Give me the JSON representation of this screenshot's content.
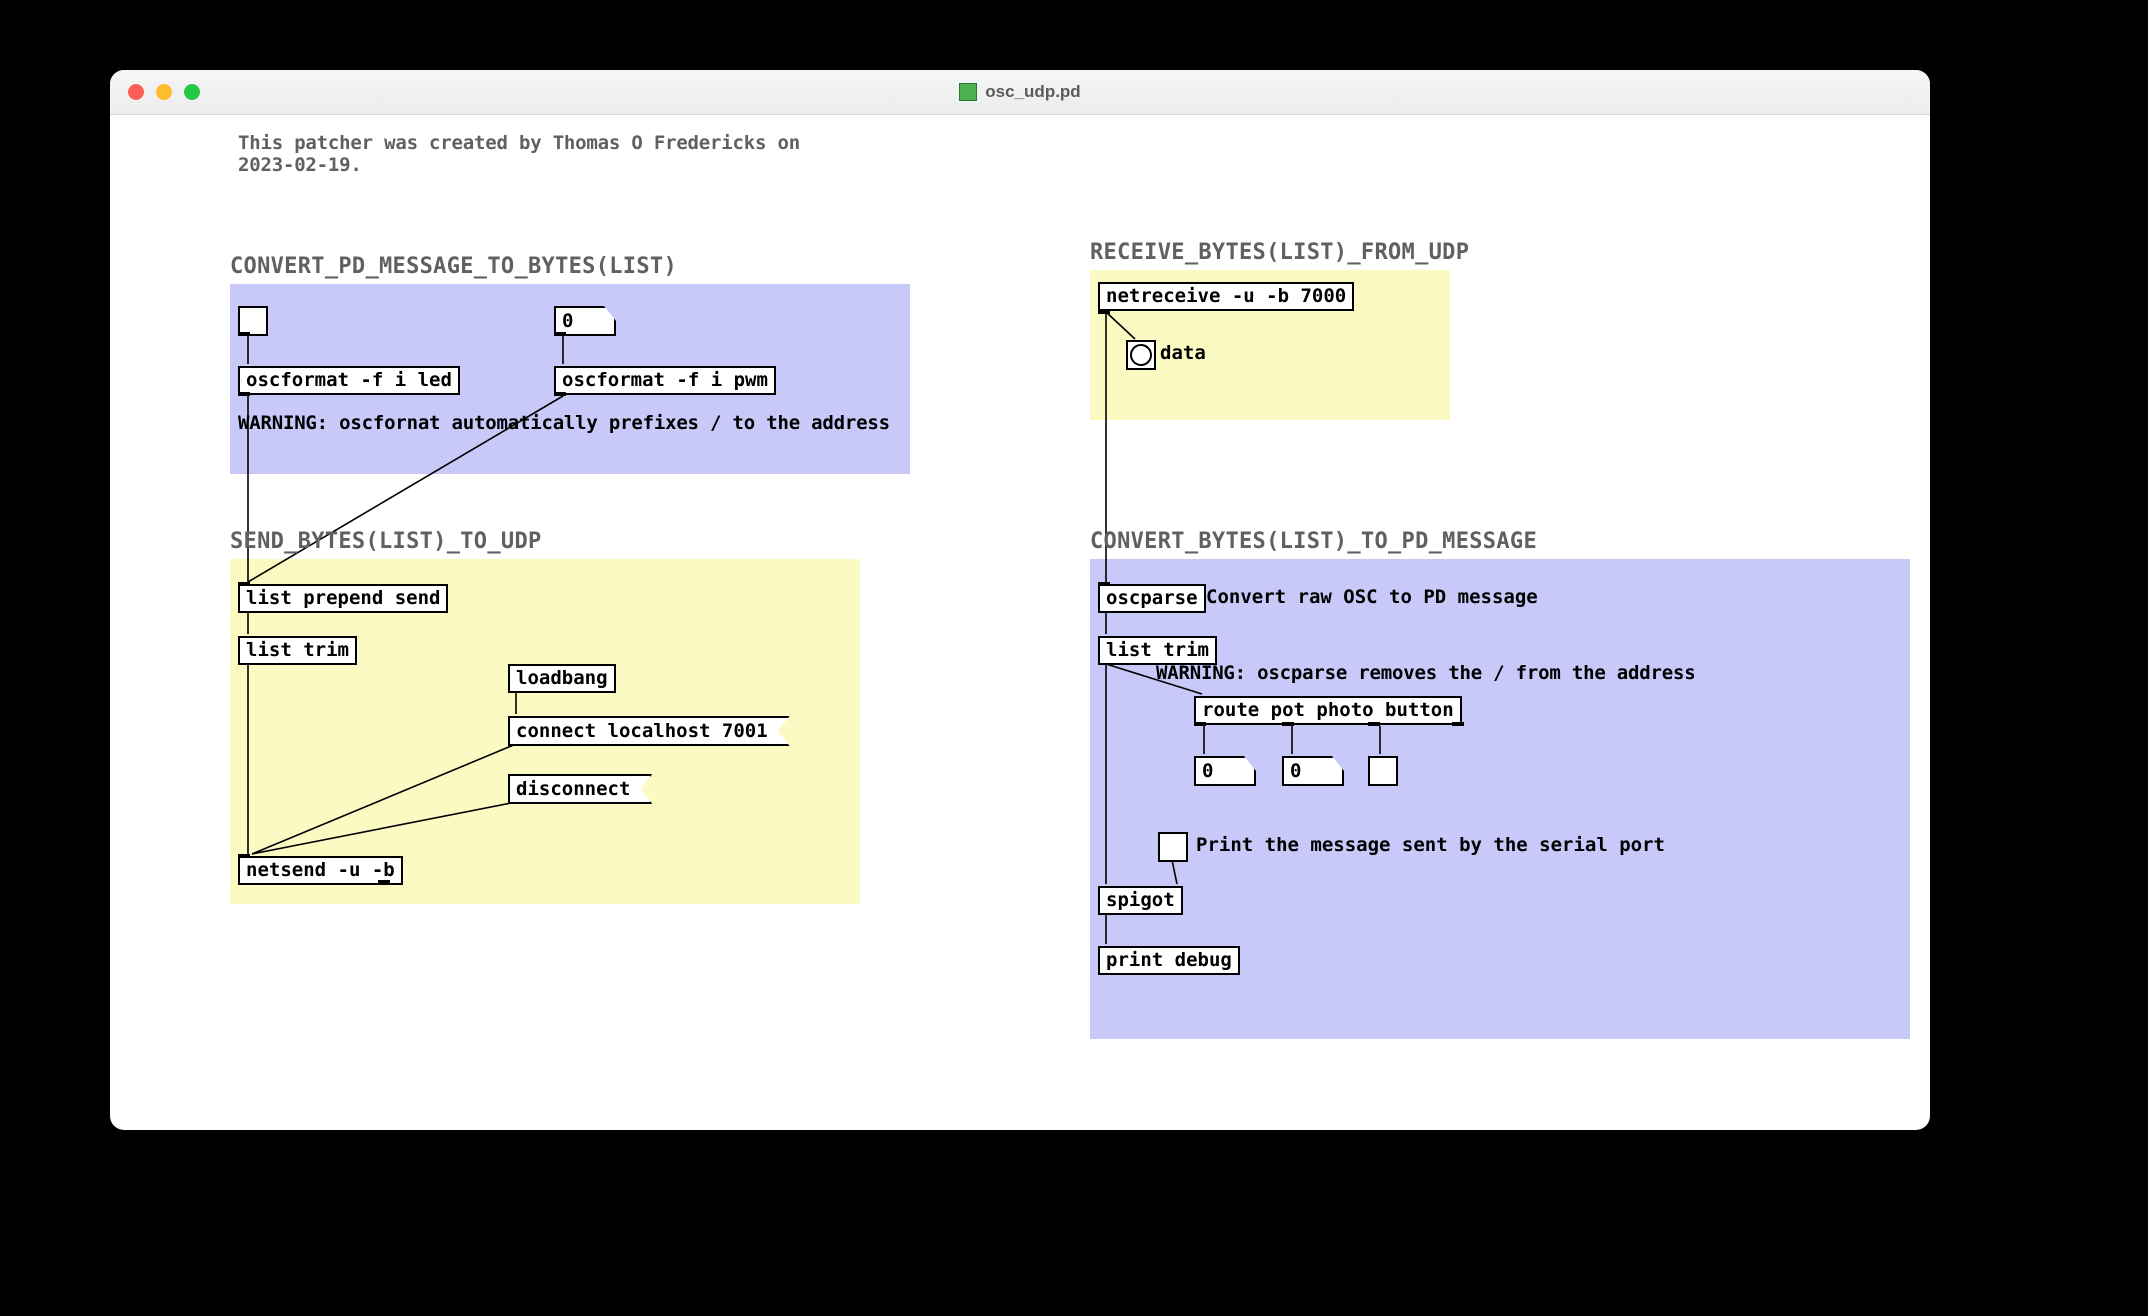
{
  "window": {
    "title": "osc_udp.pd"
  },
  "header_comment": "This patcher was created by Thomas O Fredericks on\n2023-02-19.",
  "sections": {
    "convert_to_bytes": "CONVERT_PD_MESSAGE_TO_BYTES(LIST)",
    "send_udp": "SEND_BYTES(LIST)_TO_UDP",
    "receive_udp": "RECEIVE_BYTES(LIST)_FROM_UDP",
    "convert_to_msg": "CONVERT_BYTES(LIST)_TO_PD_MESSAGE"
  },
  "objects": {
    "oscformat_led": "oscformat -f i led",
    "oscformat_pwm": "oscformat -f i pwm",
    "warn_oscformat": "WARNING: oscfornat automatically prefixes / to the address",
    "num0a": "0",
    "list_prepend_send": "list prepend send",
    "list_trim1": "list trim",
    "loadbang": "loadbang",
    "connect": "connect localhost 7001",
    "disconnect": "disconnect",
    "netsend": "netsend -u -b",
    "netreceive": "netreceive -u -b 7000",
    "data_label": "data",
    "oscparse": "oscparse",
    "oscparse_label": "Convert raw OSC to PD message",
    "list_trim2": "list trim",
    "warn_oscparse": "WARNING: oscparse removes the / from the address",
    "route": "route pot photo button",
    "num1": "0",
    "num2": "0",
    "print_label": "Print the message sent by the serial port",
    "spigot": "spigot",
    "print_debug": "print debug"
  }
}
